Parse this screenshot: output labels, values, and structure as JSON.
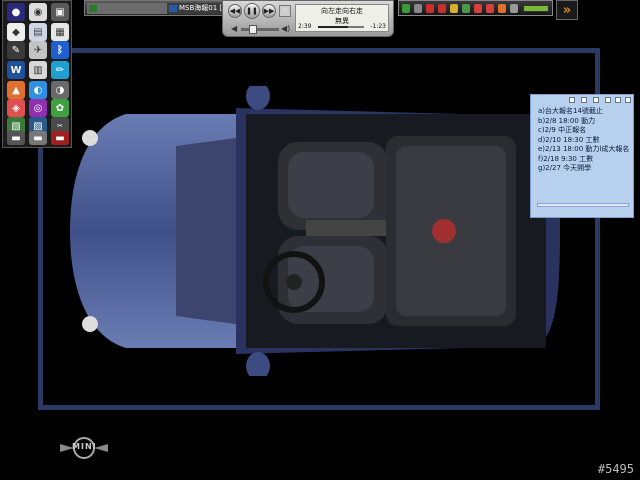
{
  "taskbar": {
    "tasks": [
      {
        "label": ""
      },
      {
        "label": "MSB海報01 [內容鏈子"
      }
    ]
  },
  "media_player": {
    "line1": "向左走向右走",
    "line2": "無異",
    "elapsed": "2:39",
    "remaining": "-1:23",
    "progress": 0.66
  },
  "sticky_note": {
    "items": [
      "a)台大報名14號截止",
      "b)2/8 18:00 動力",
      "c)2/9 中正報名",
      "d)2/10 18:30 工數",
      "e)2/13 18:00 動力l成大報名",
      "f)2/18 9:30 工數",
      "g)2/27 今天開學"
    ]
  },
  "wallpaper": {
    "logo_text": "MINI",
    "watermark": "#5495"
  },
  "colors": {
    "frame": "#2b3a63",
    "car_body": "#4a5d93",
    "note_bg": "#b6d0ee",
    "accent_orange": "#e08a1c"
  }
}
